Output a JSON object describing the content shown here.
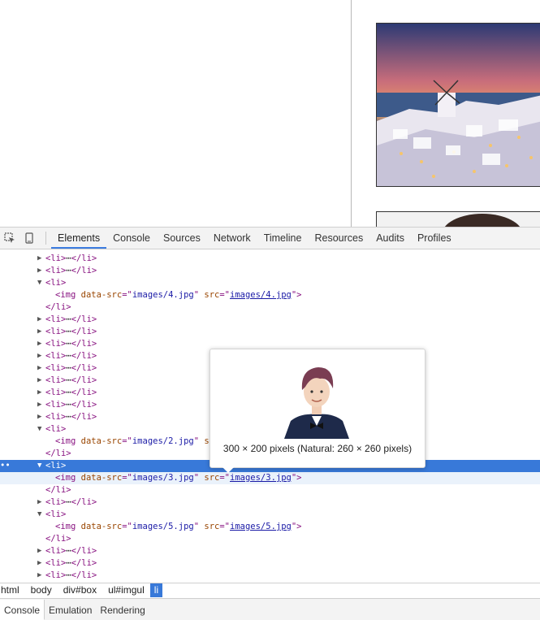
{
  "toolbar": {
    "tabs": [
      "Elements",
      "Console",
      "Sources",
      "Network",
      "Timeline",
      "Resources",
      "Audits",
      "Profiles"
    ]
  },
  "tree": {
    "li_collapsed_open": "<li>",
    "li_collapsed_close": "</li>",
    "li_open": "<li>",
    "li_close": "</li>",
    "img_tag": "img",
    "attr_data_src": "data-src",
    "attr_src": "src",
    "img4": "images/4.jpg",
    "img2": "images/2.jpg",
    "img3": "images/3.jpg",
    "img5": "images/5.jpg",
    "ellipsis": "⋯"
  },
  "tooltip": {
    "caption": "300 × 200 pixels (Natural: 260 × 260 pixels)"
  },
  "breadcrumb": {
    "items": [
      "html",
      "body",
      "div#box",
      "ul#imgul",
      "li"
    ]
  },
  "drawer": {
    "tabs": [
      "Console",
      "Emulation",
      "Rendering"
    ]
  },
  "colors": {
    "selected_row": "#3879d9",
    "active_tab_underline": "#3d7de0",
    "tag": "#881280",
    "attr": "#994500",
    "value": "#1a1aa6"
  }
}
